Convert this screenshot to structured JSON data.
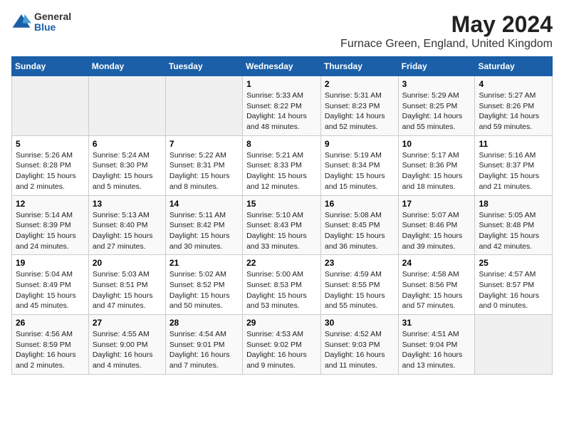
{
  "logo": {
    "general": "General",
    "blue": "Blue"
  },
  "title": "May 2024",
  "subtitle": "Furnace Green, England, United Kingdom",
  "days_header": [
    "Sunday",
    "Monday",
    "Tuesday",
    "Wednesday",
    "Thursday",
    "Friday",
    "Saturday"
  ],
  "weeks": [
    [
      {
        "day": "",
        "content": ""
      },
      {
        "day": "",
        "content": ""
      },
      {
        "day": "",
        "content": ""
      },
      {
        "day": "1",
        "content": "Sunrise: 5:33 AM\nSunset: 8:22 PM\nDaylight: 14 hours and 48 minutes."
      },
      {
        "day": "2",
        "content": "Sunrise: 5:31 AM\nSunset: 8:23 PM\nDaylight: 14 hours and 52 minutes."
      },
      {
        "day": "3",
        "content": "Sunrise: 5:29 AM\nSunset: 8:25 PM\nDaylight: 14 hours and 55 minutes."
      },
      {
        "day": "4",
        "content": "Sunrise: 5:27 AM\nSunset: 8:26 PM\nDaylight: 14 hours and 59 minutes."
      }
    ],
    [
      {
        "day": "5",
        "content": "Sunrise: 5:26 AM\nSunset: 8:28 PM\nDaylight: 15 hours and 2 minutes."
      },
      {
        "day": "6",
        "content": "Sunrise: 5:24 AM\nSunset: 8:30 PM\nDaylight: 15 hours and 5 minutes."
      },
      {
        "day": "7",
        "content": "Sunrise: 5:22 AM\nSunset: 8:31 PM\nDaylight: 15 hours and 8 minutes."
      },
      {
        "day": "8",
        "content": "Sunrise: 5:21 AM\nSunset: 8:33 PM\nDaylight: 15 hours and 12 minutes."
      },
      {
        "day": "9",
        "content": "Sunrise: 5:19 AM\nSunset: 8:34 PM\nDaylight: 15 hours and 15 minutes."
      },
      {
        "day": "10",
        "content": "Sunrise: 5:17 AM\nSunset: 8:36 PM\nDaylight: 15 hours and 18 minutes."
      },
      {
        "day": "11",
        "content": "Sunrise: 5:16 AM\nSunset: 8:37 PM\nDaylight: 15 hours and 21 minutes."
      }
    ],
    [
      {
        "day": "12",
        "content": "Sunrise: 5:14 AM\nSunset: 8:39 PM\nDaylight: 15 hours and 24 minutes."
      },
      {
        "day": "13",
        "content": "Sunrise: 5:13 AM\nSunset: 8:40 PM\nDaylight: 15 hours and 27 minutes."
      },
      {
        "day": "14",
        "content": "Sunrise: 5:11 AM\nSunset: 8:42 PM\nDaylight: 15 hours and 30 minutes."
      },
      {
        "day": "15",
        "content": "Sunrise: 5:10 AM\nSunset: 8:43 PM\nDaylight: 15 hours and 33 minutes."
      },
      {
        "day": "16",
        "content": "Sunrise: 5:08 AM\nSunset: 8:45 PM\nDaylight: 15 hours and 36 minutes."
      },
      {
        "day": "17",
        "content": "Sunrise: 5:07 AM\nSunset: 8:46 PM\nDaylight: 15 hours and 39 minutes."
      },
      {
        "day": "18",
        "content": "Sunrise: 5:05 AM\nSunset: 8:48 PM\nDaylight: 15 hours and 42 minutes."
      }
    ],
    [
      {
        "day": "19",
        "content": "Sunrise: 5:04 AM\nSunset: 8:49 PM\nDaylight: 15 hours and 45 minutes."
      },
      {
        "day": "20",
        "content": "Sunrise: 5:03 AM\nSunset: 8:51 PM\nDaylight: 15 hours and 47 minutes."
      },
      {
        "day": "21",
        "content": "Sunrise: 5:02 AM\nSunset: 8:52 PM\nDaylight: 15 hours and 50 minutes."
      },
      {
        "day": "22",
        "content": "Sunrise: 5:00 AM\nSunset: 8:53 PM\nDaylight: 15 hours and 53 minutes."
      },
      {
        "day": "23",
        "content": "Sunrise: 4:59 AM\nSunset: 8:55 PM\nDaylight: 15 hours and 55 minutes."
      },
      {
        "day": "24",
        "content": "Sunrise: 4:58 AM\nSunset: 8:56 PM\nDaylight: 15 hours and 57 minutes."
      },
      {
        "day": "25",
        "content": "Sunrise: 4:57 AM\nSunset: 8:57 PM\nDaylight: 16 hours and 0 minutes."
      }
    ],
    [
      {
        "day": "26",
        "content": "Sunrise: 4:56 AM\nSunset: 8:59 PM\nDaylight: 16 hours and 2 minutes."
      },
      {
        "day": "27",
        "content": "Sunrise: 4:55 AM\nSunset: 9:00 PM\nDaylight: 16 hours and 4 minutes."
      },
      {
        "day": "28",
        "content": "Sunrise: 4:54 AM\nSunset: 9:01 PM\nDaylight: 16 hours and 7 minutes."
      },
      {
        "day": "29",
        "content": "Sunrise: 4:53 AM\nSunset: 9:02 PM\nDaylight: 16 hours and 9 minutes."
      },
      {
        "day": "30",
        "content": "Sunrise: 4:52 AM\nSunset: 9:03 PM\nDaylight: 16 hours and 11 minutes."
      },
      {
        "day": "31",
        "content": "Sunrise: 4:51 AM\nSunset: 9:04 PM\nDaylight: 16 hours and 13 minutes."
      },
      {
        "day": "",
        "content": ""
      }
    ]
  ]
}
